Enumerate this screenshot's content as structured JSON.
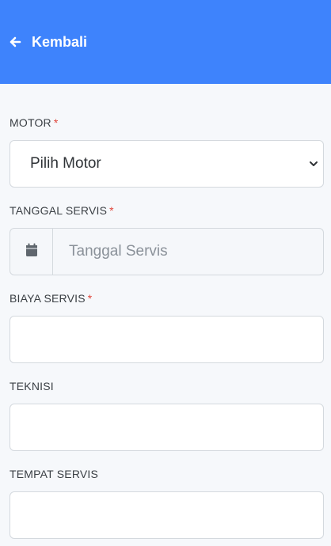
{
  "header": {
    "back_label": "Kembali",
    "back_icon": "arrow-left-icon",
    "bg_color": "#3e83fc"
  },
  "form": {
    "motor": {
      "label": "MOTOR",
      "required_mark": "*",
      "selected": "Pilih Motor"
    },
    "tanggal_servis": {
      "label": "TANGGAL SERVIS",
      "required_mark": "*",
      "placeholder": "Tanggal Servis",
      "icon": "calendar-icon"
    },
    "biaya_servis": {
      "label": "BIAYA SERVIS",
      "required_mark": "*",
      "value": ""
    },
    "teknisi": {
      "label": "TEKNISI",
      "value": ""
    },
    "tempat_servis": {
      "label": "TEMPAT SERVIS",
      "value": ""
    }
  }
}
